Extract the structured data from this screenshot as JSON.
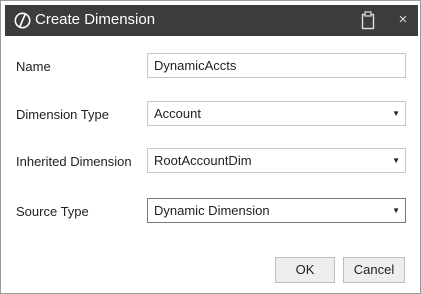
{
  "window": {
    "title": "Create Dimension",
    "logo_icon": "oracle-logo-icon",
    "clipboard_icon": "clipboard-icon",
    "close_glyph": "×"
  },
  "form": {
    "name": {
      "label": "Name",
      "value": "DynamicAccts"
    },
    "dimension_type": {
      "label": "Dimension Type",
      "value": "Account"
    },
    "inherited_dimension": {
      "label": "Inherited Dimension",
      "value": "RootAccountDim"
    },
    "source_type": {
      "label": "Source Type",
      "value": "Dynamic Dimension"
    }
  },
  "buttons": {
    "ok": "OK",
    "cancel": "Cancel"
  },
  "colors": {
    "titlebar": "#3c3c3c",
    "title_text": "#ffffff",
    "field_border": "#c8c8c8",
    "button_bg": "#eeeeee"
  }
}
